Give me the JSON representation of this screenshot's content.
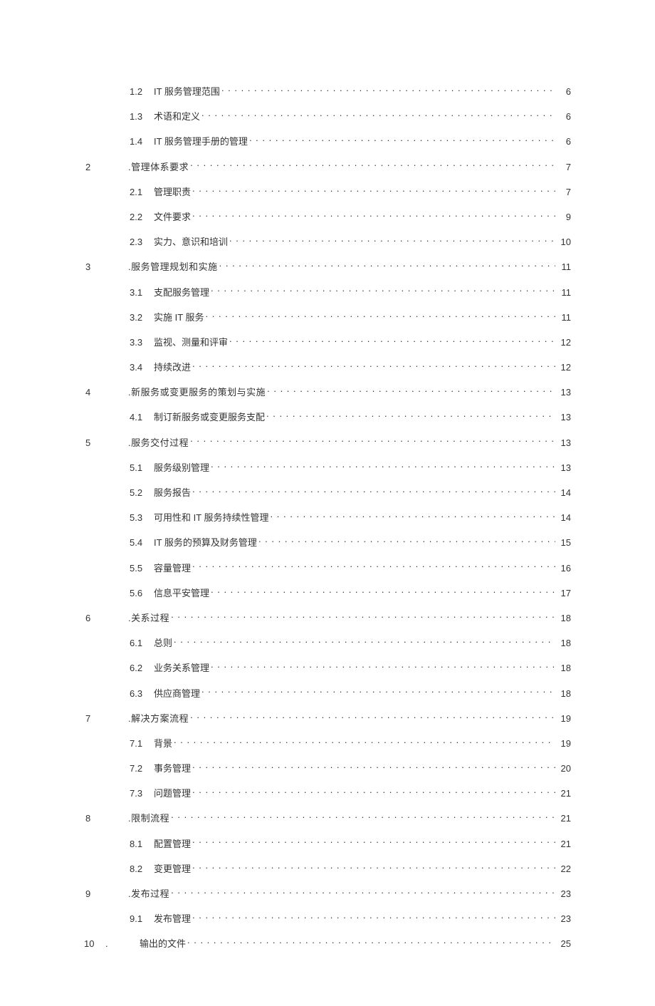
{
  "toc": [
    {
      "type": "sub",
      "num": "1.2",
      "title": "IT 服务管理范围",
      "page": "6"
    },
    {
      "type": "sub",
      "num": "1.3",
      "title": "术语和定义",
      "page": "6"
    },
    {
      "type": "sub",
      "num": "1.4",
      "title": "IT 服务管理手册的管理",
      "page": "6"
    },
    {
      "type": "top",
      "num": "2",
      "title": ".管理体系要求",
      "page": "7"
    },
    {
      "type": "sub",
      "num": "2.1",
      "title": "管理职责",
      "page": "7"
    },
    {
      "type": "sub",
      "num": "2.2",
      "title": "文件要求 ",
      "page": "9"
    },
    {
      "type": "sub",
      "num": "2.3",
      "title": "实力、意识和培训 ",
      "page": "10"
    },
    {
      "type": "top",
      "num": "3",
      "title": ".服务管理规划和实施",
      "page": "11"
    },
    {
      "type": "sub",
      "num": "3.1",
      "title": "支配服务管理",
      "page": "11"
    },
    {
      "type": "sub",
      "num": "3.2",
      "title": "实施 IT 服务 ",
      "page": "11"
    },
    {
      "type": "sub",
      "num": "3.3",
      "title": "监视、测量和评审 ",
      "page": "12"
    },
    {
      "type": "sub",
      "num": "3.4",
      "title": "持续改进 ",
      "page": "12"
    },
    {
      "type": "top",
      "num": "4",
      "title": ".新服务或变更服务的策划与实施",
      "page": "13"
    },
    {
      "type": "sub",
      "num": "4.1",
      "title": "制订新服务或变更服务支配",
      "page": "13"
    },
    {
      "type": "top",
      "num": "5",
      "title": ".服务交付过程",
      "page": "13"
    },
    {
      "type": "sub",
      "num": "5.1",
      "title": "服务级别管理",
      "page": "13"
    },
    {
      "type": "sub",
      "num": "5.2",
      "title": "服务报告 ",
      "page": "14"
    },
    {
      "type": "sub",
      "num": "5.3",
      "title": "可用性和 IT 服务持续性管理",
      "page": "14"
    },
    {
      "type": "sub",
      "num": "5.4",
      "title": "IT 服务的预算及财务管理 ",
      "page": "15"
    },
    {
      "type": "sub",
      "num": "5.5",
      "title": "容量管理 ",
      "page": "16"
    },
    {
      "type": "sub",
      "num": "5.6",
      "title": "信息平安管理 ",
      "page": "17"
    },
    {
      "type": "top",
      "num": "6",
      "title": ".关系过程",
      "page": "18"
    },
    {
      "type": "sub",
      "num": "6.1",
      "title": "总则",
      "page": "18"
    },
    {
      "type": "sub",
      "num": "6.2",
      "title": "业务关系管理 ",
      "page": "18"
    },
    {
      "type": "sub",
      "num": "6.3",
      "title": "供应商管理 ",
      "page": "18"
    },
    {
      "type": "top",
      "num": "7",
      "title": ".解决方案流程",
      "page": "19"
    },
    {
      "type": "sub",
      "num": "7.1",
      "title": "背景",
      "page": "19"
    },
    {
      "type": "sub",
      "num": "7.2",
      "title": "事务管理 ",
      "page": "20"
    },
    {
      "type": "sub",
      "num": "7.3",
      "title": "问题管理 ",
      "page": "21"
    },
    {
      "type": "top",
      "num": "8",
      "title": ".限制流程",
      "page": "21"
    },
    {
      "type": "sub",
      "num": "8.1",
      "title": "配置管理",
      "page": "21"
    },
    {
      "type": "sub",
      "num": "8.2",
      "title": "变更管理 ",
      "page": "22"
    },
    {
      "type": "top",
      "num": "9",
      "title": ".发布过程",
      "page": "23"
    },
    {
      "type": "sub",
      "num": "9.1",
      "title": "发布管理",
      "page": "23"
    },
    {
      "type": "top10",
      "num": "10",
      "dot": ".",
      "title": "输出的文件",
      "page": "25"
    }
  ]
}
